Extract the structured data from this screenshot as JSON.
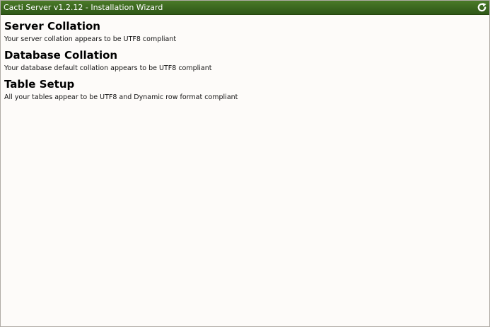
{
  "window": {
    "title": "Cacti Server v1.2.12 - Installation Wizard",
    "refresh_icon": "refresh-icon"
  },
  "sections": [
    {
      "heading": "Server Collation",
      "message": "Your server collation appears to be UTF8 compliant"
    },
    {
      "heading": "Database Collation",
      "message": "Your database default collation appears to be UTF8 compliant"
    },
    {
      "heading": "Table Setup",
      "message": "All your tables appear to be UTF8 and Dynamic row format compliant"
    }
  ],
  "colors": {
    "titlebar": "#3d6b22",
    "background": "#fdfbf9"
  }
}
